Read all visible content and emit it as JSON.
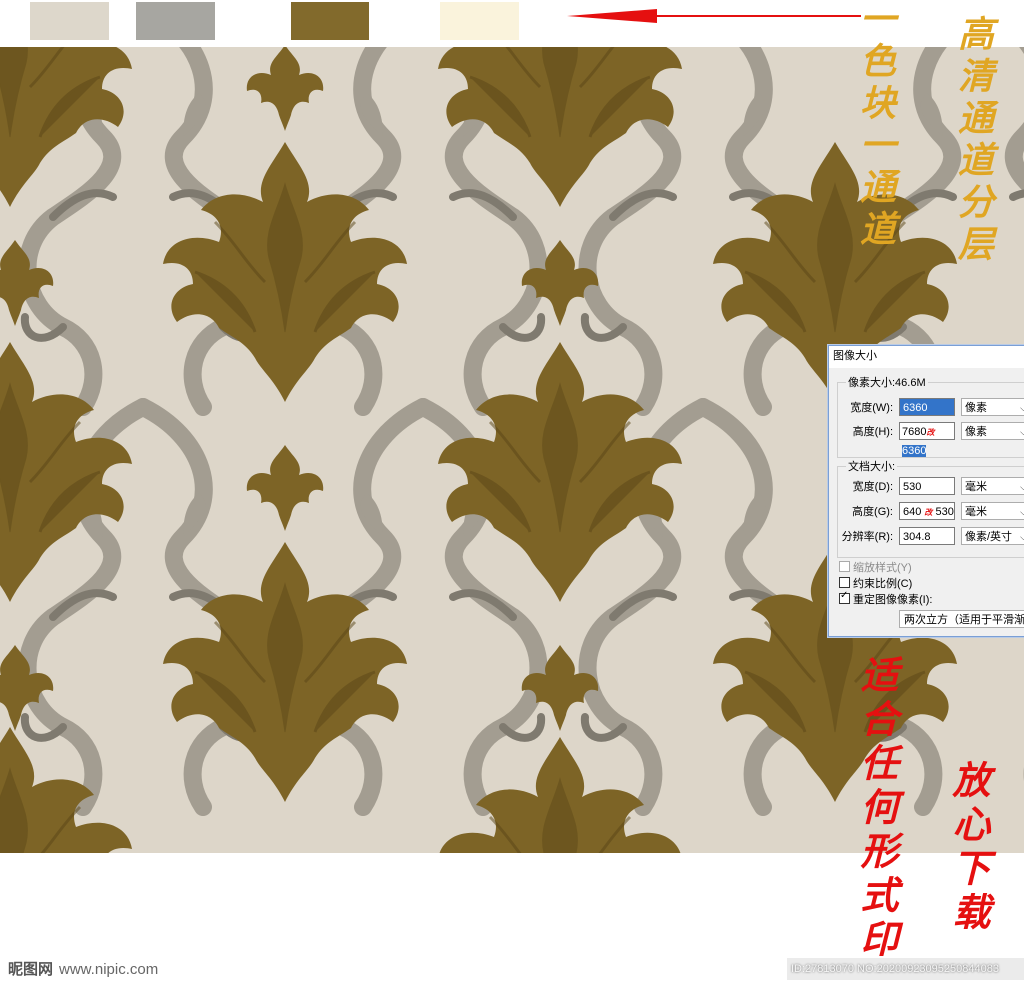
{
  "colors": {
    "swatch_1": "#ddd7cb",
    "swatch_2": "#a7a6a1",
    "swatch_3": "#826a2c",
    "swatch_4": "#faf3dc",
    "arrow": "#e51010",
    "background": "#ddd6c9",
    "gold": "#7d6426",
    "gold_dark": "#5a4617",
    "gray_scroll": "#a39d91",
    "gray_scroll_dark": "#7f7a6f",
    "note_gold": "#e0a623",
    "note_red": "#e51010"
  },
  "notes": {
    "color_block": "一色块一通道",
    "hd_channel": "高清通道分层",
    "suitable": "适合任何形式印",
    "download": "放心下载"
  },
  "dialog": {
    "title": "图像大小",
    "pixel_size_label": "像素大小:46.6M",
    "width_label": "宽度(W):",
    "width_value": "6360",
    "width_unit": "像素",
    "height_label": "高度(H):",
    "height_old": "7680",
    "height_mark": "改",
    "height_value": "6360",
    "height_unit": "像素",
    "doc_size_label": "文档大小:",
    "doc_width_label": "宽度(D):",
    "doc_width_value": "530",
    "doc_width_unit": "毫米",
    "doc_height_label": "高度(G):",
    "doc_height_old": "640",
    "doc_height_mark": "改",
    "doc_height_new": "530",
    "doc_height_unit": "毫米",
    "resolution_label": "分辨率(R):",
    "resolution_value": "304.8",
    "resolution_unit": "像素/英寸",
    "scale_styles": "缩放样式(Y)",
    "constrain": "约束比例(C)",
    "resample": "重定图像像素(I):",
    "resample_method": "两次立方（适用于平滑渐变"
  },
  "watermark": {
    "logo": "昵图网",
    "site": "www.nipic.com",
    "id_text": "ID:27813070 NO:20200923095250844083"
  }
}
